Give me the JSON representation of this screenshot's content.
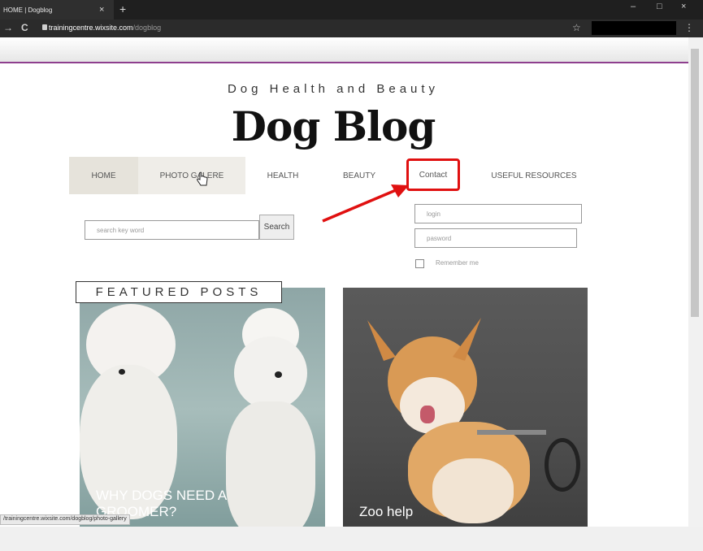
{
  "browser": {
    "tab_title": "HOME | Dogblog",
    "tab_close": "×",
    "new_tab": "+",
    "url_domain": "trainingcentre.wixsite.com",
    "url_path": "/dogblog",
    "status_url": "/trainingcentre.wixsite.com/dogblog/photo-gallery",
    "window_controls": [
      "–",
      "□",
      "×"
    ],
    "nav_back": "→",
    "nav_reload": "C",
    "bookmark": "☆",
    "menu": "⋮"
  },
  "site": {
    "subtitle": "Dog Health and Beauty",
    "title": "Dog Blog"
  },
  "nav": {
    "home": "HOME",
    "photo": "PHOTO GALERE",
    "health": "HEALTH",
    "beauty": "BEAUTY",
    "contact": "Contact",
    "useful": "USEFUL RESOURCES"
  },
  "search": {
    "placeholder": "search key word",
    "button": "Search"
  },
  "login": {
    "login_placeholder": "login",
    "password_placeholder": "pasword",
    "remember": "Remember me"
  },
  "featured": {
    "label": "FEATURED POSTS",
    "posts": [
      {
        "caption": "WHY DOGS NEED A GROOMER?"
      },
      {
        "caption": "Zoo help"
      }
    ]
  },
  "annotation_color": "#e01010"
}
